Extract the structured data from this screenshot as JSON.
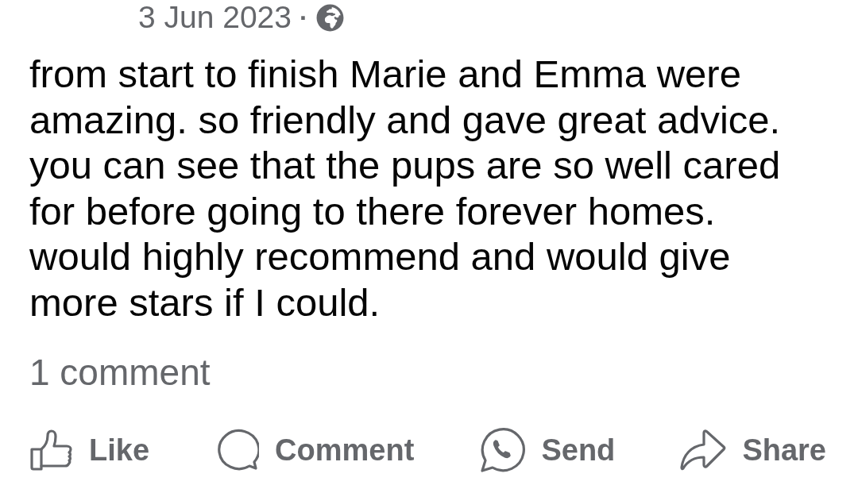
{
  "post": {
    "date": "3 Jun 2023",
    "separator": "·",
    "body": "from start to finish Marie and Emma were amazing. so friendly and gave great advice. you can see that the pups are so well cared for before going to there forever homes. would highly recommend and would give more stars if I could.",
    "comment_count": "1 comment"
  },
  "actions": [
    {
      "kind": "like",
      "label": "Like"
    },
    {
      "kind": "comment",
      "label": "Comment"
    },
    {
      "kind": "send",
      "label": "Send"
    },
    {
      "kind": "share",
      "label": "Share"
    }
  ]
}
